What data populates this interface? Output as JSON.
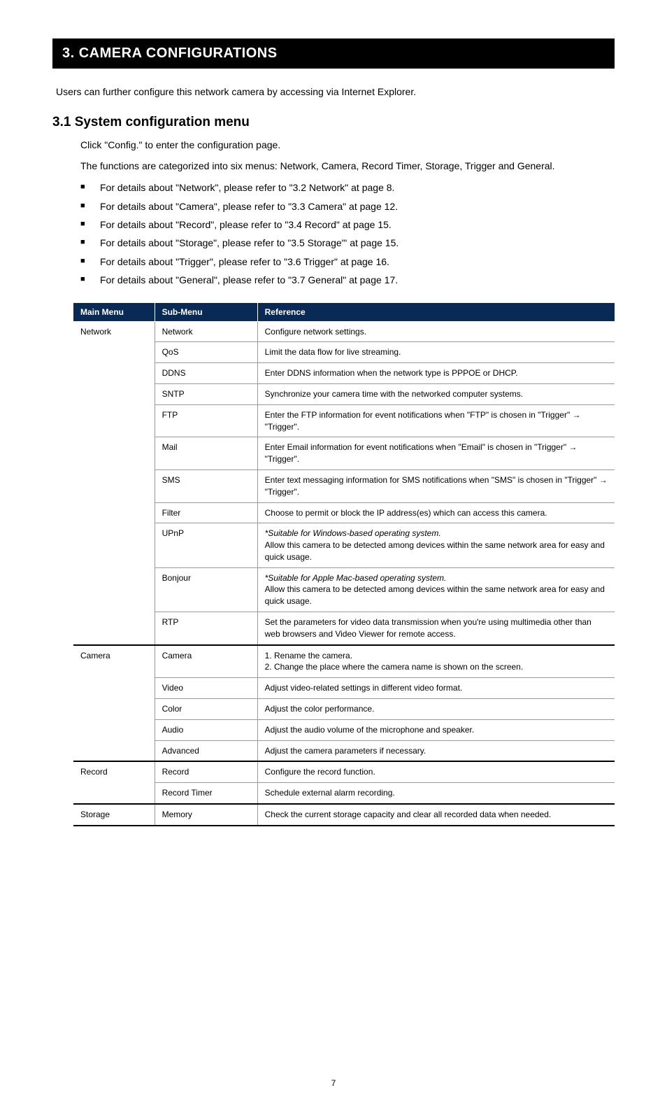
{
  "header": "3. CAMERA CONFIGURATIONS",
  "intro": "Users can further configure this network camera by accessing via Internet Explorer.",
  "subsection": "3.1 System configuration menu",
  "para1": "Click \"Config.\" to enter the configuration page.",
  "para2": "The functions are categorized into six menus: Network, Camera, Record Timer, Storage, Trigger and General.",
  "bullets": [
    "For details about \"Network\", please refer to \"3.2 Network\" at page 8.",
    "For details about \"Camera\", please refer to \"3.3 Camera\" at page 12.",
    "For details about \"Record\", please refer to \"3.4 Record\" at page 15.",
    "For details about \"Storage\", please refer to \"3.5 Storage\"' at page 15.",
    "For details about \"Trigger\", please refer to \"3.6 Trigger\" at page 16.",
    "For details about \"General\", please refer to \"3.7 General\" at page 17."
  ],
  "table": {
    "headers": {
      "main": "Main Menu",
      "sub": "Sub-Menu",
      "ref": "Reference"
    },
    "rows": [
      {
        "main": "Network",
        "sub": "Network",
        "ref": "Configure network settings."
      },
      {
        "main": "",
        "sub": "QoS",
        "ref": "Limit the data flow for live streaming."
      },
      {
        "main": "",
        "sub": "DDNS",
        "ref": "Enter DDNS information when the network type is PPPOE or DHCP."
      },
      {
        "main": "",
        "sub": "SNTP",
        "ref": "Synchronize your camera time with the networked computer systems."
      },
      {
        "main": "",
        "sub": "FTP",
        "ref": "Enter the FTP information for event notifications when \"FTP\" is chosen in \"Trigger\" → \"Trigger\"."
      },
      {
        "main": "",
        "sub": "Mail",
        "ref": "Enter Email information for event notifications when \"Email\" is chosen in \"Trigger\" → \"Trigger\"."
      },
      {
        "main": "",
        "sub": "SMS",
        "ref": "Enter text messaging information for SMS notifications when \"SMS\" is chosen in \"Trigger\" → \"Trigger\"."
      },
      {
        "main": "",
        "sub": "Filter",
        "ref": "Choose to permit or block the IP address(es) which can access this camera."
      },
      {
        "main": "",
        "sub": "UPnP",
        "italic": "*Suitable for Windows-based operating system.",
        "ref": "Allow this camera to be detected among devices within the same network area for easy and quick usage."
      },
      {
        "main": "",
        "sub": "Bonjour",
        "italic": "*Suitable for Apple Mac-based operating system.",
        "ref": "Allow this camera to be detected among devices within the same network area for easy and quick usage."
      },
      {
        "main": "",
        "sub": "RTP",
        "ref": "Set the parameters for video data transmission when you're using multimedia other than web browsers and Video Viewer for remote access."
      },
      {
        "main": "Camera",
        "sub": "Camera",
        "ref": "1. Rename the camera.",
        "ref2": "2. Change the place where the camera name is shown on the screen."
      },
      {
        "main": "",
        "sub": "Video",
        "ref": "Adjust video-related settings in different video format."
      },
      {
        "main": "",
        "sub": "Color",
        "ref": "Adjust the color performance."
      },
      {
        "main": "",
        "sub": "Audio",
        "ref": "Adjust the audio volume of the microphone and speaker."
      },
      {
        "main": "",
        "sub": "Advanced",
        "ref": "Adjust the camera parameters if necessary."
      },
      {
        "main": "Record",
        "sub": "Record",
        "ref": "Configure the record function."
      },
      {
        "main": "",
        "sub": "Record Timer",
        "ref": "Schedule external alarm recording."
      },
      {
        "main": "Storage",
        "sub": "Memory",
        "ref": "Check the current storage capacity and clear all recorded data when needed."
      }
    ]
  },
  "page_number": "7"
}
